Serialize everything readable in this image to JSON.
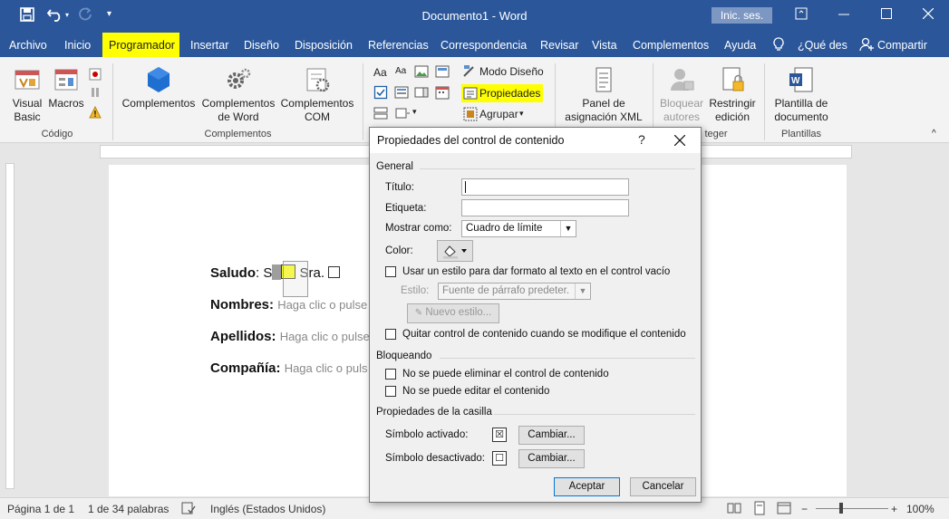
{
  "titlebar": {
    "title": "Documento1 - Word",
    "signin": "Inic. ses.",
    "save_icon": "save-icon",
    "undo_icon": "undo-icon",
    "redo_icon": "redo-icon"
  },
  "tabs": {
    "archivo": "Archivo",
    "inicio": "Inicio",
    "programador": "Programador",
    "insertar": "Insertar",
    "diseno": "Diseño",
    "disposicion": "Disposición",
    "referencias": "Referencias",
    "correspondencia": "Correspondencia",
    "revisar": "Revisar",
    "vista": "Vista",
    "complementos": "Complementos",
    "ayuda": "Ayuda",
    "que_des": "¿Qué des",
    "compartir": "Compartir"
  },
  "ribbon": {
    "visual_basic_1": "Visual",
    "visual_basic_2": "Basic",
    "macros": "Macros",
    "grupo_codigo": "Código",
    "complementos": "Complementos",
    "compl_word_1": "Complementos",
    "compl_word_2": "de Word",
    "compl_com_1": "Complementos",
    "compl_com_2": "COM",
    "grupo_complementos": "Complementos",
    "modo_diseno": "Modo Diseño",
    "propiedades": "Propiedades",
    "agrupar": "Agrupar",
    "panel_1": "Panel de",
    "panel_2": "asignación XML",
    "bloquear_1": "Bloquear",
    "bloquear_2": "autores",
    "restringir_1": "Restringir",
    "restringir_2": "edición",
    "grupo_proteger": "teger",
    "plantilla_1": "Plantilla de",
    "plantilla_2": "documento",
    "grupo_plantillas": "Plantillas"
  },
  "document": {
    "saludo_label": "Saludo",
    "saludo_sep": ": S",
    "sra": "Sra.",
    "nombres_label": "Nombres:",
    "nombres_ph": "Haga clic o pulse",
    "apellidos_label": "Apellidos:",
    "apellidos_ph": "Haga clic o pulse",
    "compania_label": "Compañía:",
    "compania_ph": "Haga clic o puls"
  },
  "dialog": {
    "title": "Propiedades del control de contenido",
    "help": "?",
    "general": "General",
    "titulo_label": "Título:",
    "titulo_value": "",
    "etiqueta_label": "Etiqueta:",
    "etiqueta_value": "",
    "mostrar_label": "Mostrar como:",
    "mostrar_value": "Cuadro de límite",
    "color_label": "Color:",
    "usar_estilo": "Usar un estilo para dar formato al texto en el control vacío",
    "estilo_label": "Estilo:",
    "estilo_value": "Fuente de párrafo predeter.",
    "nuevo_estilo": "Nuevo estilo...",
    "quitar_control": "Quitar control de contenido cuando se modifique el contenido",
    "bloqueando": "Bloqueando",
    "no_eliminar": "No se puede eliminar el control de contenido",
    "no_editar": "No se puede editar el contenido",
    "casilla": "Propiedades de la casilla",
    "simbolo_activado": "Símbolo activado:",
    "simbolo_desactivado": "Símbolo desactivado:",
    "cambiar_1": "Cambiar...",
    "cambiar_2": "Cambiar...",
    "aceptar": "Aceptar",
    "cancelar": "Cancelar",
    "checked_symbol": "☒",
    "unchecked_symbol": "☐"
  },
  "statusbar": {
    "pagina": "Página 1 de 1",
    "palabras": "1 de 34 palabras",
    "idioma": "Inglés (Estados Unidos)",
    "zoom": "100%"
  },
  "colors": {
    "word_blue": "#2b579a",
    "highlight": "#ffff00"
  }
}
